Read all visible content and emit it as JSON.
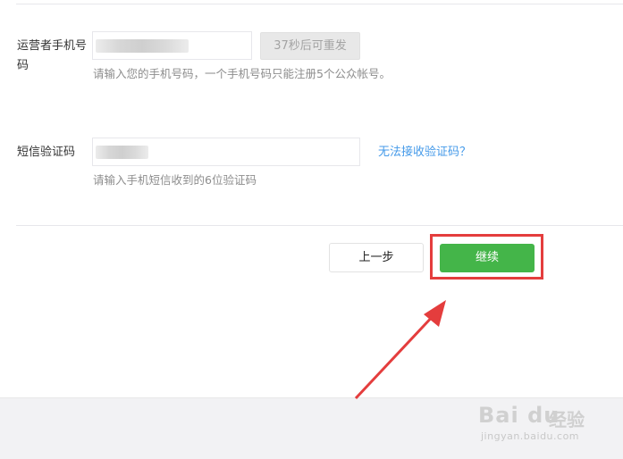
{
  "form": {
    "phone": {
      "label": "运营者手机号码",
      "resend_button": "37秒后可重发",
      "hint": "请输入您的手机号码，一个手机号码只能注册5个公众帐号。"
    },
    "sms": {
      "label": "短信验证码",
      "no_code_link": "无法接收验证码？",
      "hint": "请输入手机短信收到的6位验证码"
    }
  },
  "actions": {
    "prev_label": "上一步",
    "next_label": "继续"
  },
  "watermark": {
    "logo": "Bai du",
    "logo_suffix": "经验",
    "url": "jingyan.baidu.com"
  },
  "colors": {
    "primary_green": "#44b549",
    "link_blue": "#459ae9",
    "highlight_red": "#e43d3d"
  }
}
